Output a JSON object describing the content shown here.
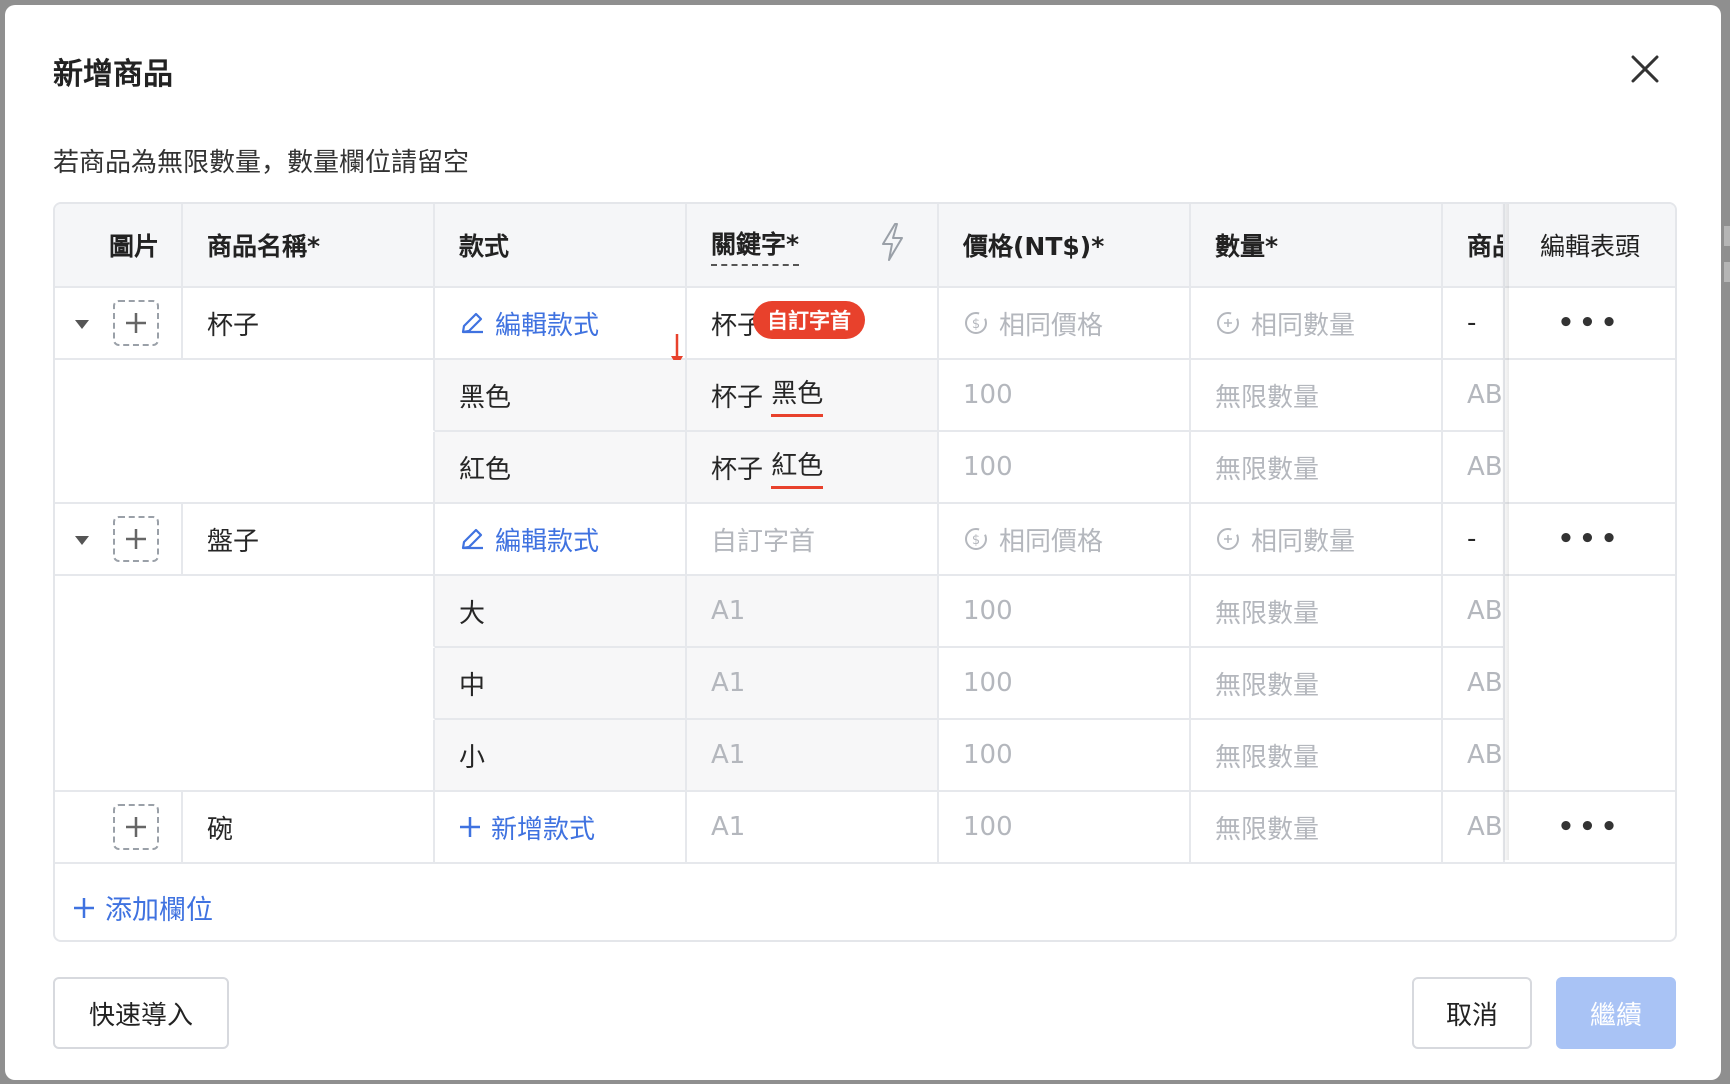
{
  "modal": {
    "title": "新增商品",
    "hint": "若商品為無限數量，數量欄位請留空"
  },
  "table": {
    "headers": {
      "image": "圖片",
      "name": "商品名稱*",
      "variant": "款式",
      "keyword": "關鍵字*",
      "price": "價格(NT$)*",
      "quantity": "數量*",
      "extra": "商品",
      "edit_header": "編輯表頭"
    },
    "edit_variant_label": "編輯款式",
    "add_variant_label": "新增款式",
    "same_price": "相同價格",
    "same_qty": "相同數量",
    "keyword_placeholder": "自訂字首",
    "unlimited": "無限數量",
    "badge": "自訂字首",
    "dash": "-",
    "more": "•••",
    "products": [
      {
        "name": "杯子",
        "keyword": "杯子",
        "variants": [
          {
            "name": "黑色",
            "kw_prefix": "杯子",
            "kw_suffix": "黑色",
            "price": "100",
            "extra": "AB"
          },
          {
            "name": "紅色",
            "kw_prefix": "杯子",
            "kw_suffix": "紅色",
            "price": "100",
            "extra": "AB"
          }
        ]
      },
      {
        "name": "盤子",
        "variants": [
          {
            "name": "大",
            "keyword": "A1",
            "price": "100",
            "extra": "AB"
          },
          {
            "name": "中",
            "keyword": "A1",
            "price": "100",
            "extra": "AB"
          },
          {
            "name": "小",
            "keyword": "A1",
            "price": "100",
            "extra": "AB"
          }
        ]
      },
      {
        "name": "碗",
        "keyword": "A1",
        "price": "100",
        "extra": "AB"
      }
    ],
    "add_column": "添加欄位"
  },
  "footer": {
    "import": "快速導入",
    "cancel": "取消",
    "continue": "繼續"
  },
  "colors": {
    "accent": "#3f72e0",
    "badge": "#e8412c",
    "continue_disabled": "#a9c3f5"
  },
  "icons": [
    "close-icon",
    "lightning-icon",
    "plus-icon",
    "edit-icon",
    "dollar-cycle-icon",
    "refresh-icon",
    "caret-down-icon",
    "more-icon",
    "arrow-down-icon"
  ]
}
